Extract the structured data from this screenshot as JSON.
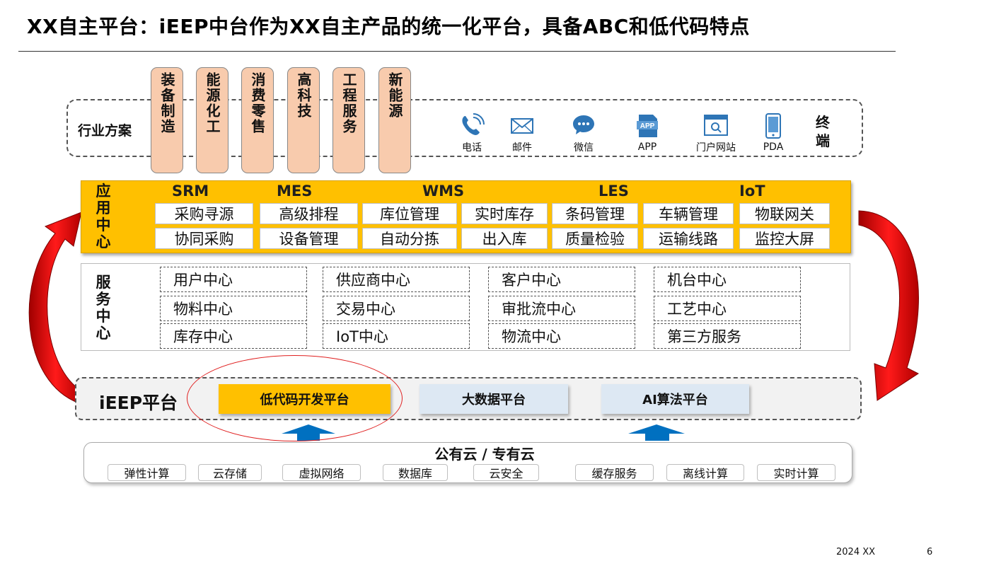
{
  "title": "XX自主平台：iEEP中台作为XX自主产品的统一化平台，具备ABC和低代码特点",
  "industry": {
    "label": "行业方案",
    "cards": [
      "装备制造",
      "能源化工",
      "消费零售",
      "高科技",
      "工程服务",
      "新能源"
    ]
  },
  "terminals": {
    "items": [
      {
        "label": "电话",
        "icon": "phone-icon"
      },
      {
        "label": "邮件",
        "icon": "mail-icon"
      },
      {
        "label": "微信",
        "icon": "wechat-icon"
      },
      {
        "label": "APP",
        "icon": "app-icon"
      },
      {
        "label": "门户网站",
        "icon": "portal-icon"
      },
      {
        "label": "PDA",
        "icon": "pda-icon"
      }
    ],
    "end_label": "终端"
  },
  "app_center": {
    "label": "应用中心",
    "headers": [
      "SRM",
      "MES",
      "WMS",
      "LES",
      "IoT"
    ],
    "row1": [
      "采购寻源",
      "高级排程",
      "库位管理",
      "实时库存",
      "条码管理",
      "车辆管理",
      "物联网关"
    ],
    "row2": [
      "协同采购",
      "设备管理",
      "自动分拣",
      "出入库",
      "质量检验",
      "运输线路",
      "监控大屏"
    ]
  },
  "service_center": {
    "label": "服务中心",
    "cells": [
      "用户中心",
      "供应商中心",
      "客户中心",
      "机台中心",
      "物料中心",
      "交易中心",
      "审批流中心",
      "工艺中心",
      "库存中心",
      "IoT中心",
      "物流中心",
      "第三方服务"
    ]
  },
  "ieep": {
    "label": "iEEP平台",
    "platforms": [
      "低代码开发平台",
      "大数据平台",
      "AI算法平台"
    ]
  },
  "cloud": {
    "title": "公有云 / 专有云",
    "items": [
      "弹性计算",
      "云存储",
      "虚拟网络",
      "数据库",
      "云安全",
      "缓存服务",
      "离线计算",
      "实时计算"
    ]
  },
  "footer": {
    "year": "2024 XX",
    "page": "6"
  },
  "colors": {
    "gold": "#ffc000",
    "peach": "#f8cbad",
    "light_blue": "#dde8f3",
    "arrow_red": "#e00000",
    "arrow_blue": "#0070c0",
    "icon_blue": "#2e75b6"
  }
}
